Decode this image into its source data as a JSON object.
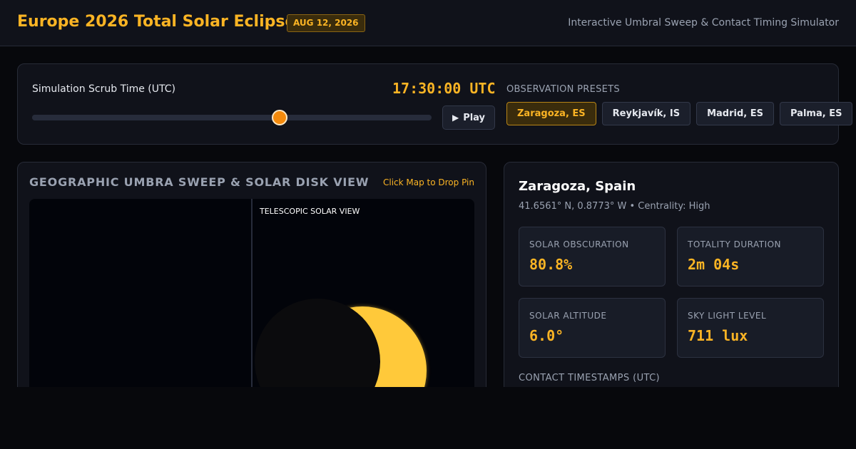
{
  "header": {
    "title": "Europe 2026 Total Solar Eclipse",
    "date_badge": "AUG 12, 2026",
    "subtitle": "Interactive Umbral Sweep & Contact Timing Simulator"
  },
  "scrub": {
    "label": "Simulation Scrub Time (UTC)",
    "time": "17:30:00 UTC",
    "progress": 0.619,
    "play_label": "Play",
    "play_icon": "play-icon"
  },
  "presets": {
    "label": "OBSERVATION PRESETS",
    "items": [
      {
        "label": "Zaragoza, ES",
        "active": true
      },
      {
        "label": "Reykjavík, IS",
        "active": false
      },
      {
        "label": "Madrid, ES",
        "active": false
      },
      {
        "label": "Palma, ES",
        "active": false
      }
    ]
  },
  "map": {
    "title": "GEOGRAPHIC UMBRA SWEEP & SOLAR DISK VIEW",
    "hint": "Click Map to Drop Pin",
    "scope_label": "TELESCOPIC SOLAR VIEW"
  },
  "location": {
    "name": "Zaragoza, Spain",
    "coords": "41.6561° N, 0.8773° W • Centrality: High",
    "metrics": [
      {
        "label": "SOLAR OBSCURATION",
        "value": "80.8%"
      },
      {
        "label": "TOTALITY DURATION",
        "value": "2m 04s"
      },
      {
        "label": "SOLAR ALTITUDE",
        "value": "6.0°"
      },
      {
        "label": "SKY LIGHT LEVEL",
        "value": "711 lux"
      }
    ],
    "contact_label": "CONTACT TIMESTAMPS (UTC)"
  },
  "colors": {
    "accent": "#fbb424",
    "thumb": "#f48a0c",
    "sun": "#ffc93a",
    "moon": "#0b0b0d"
  }
}
